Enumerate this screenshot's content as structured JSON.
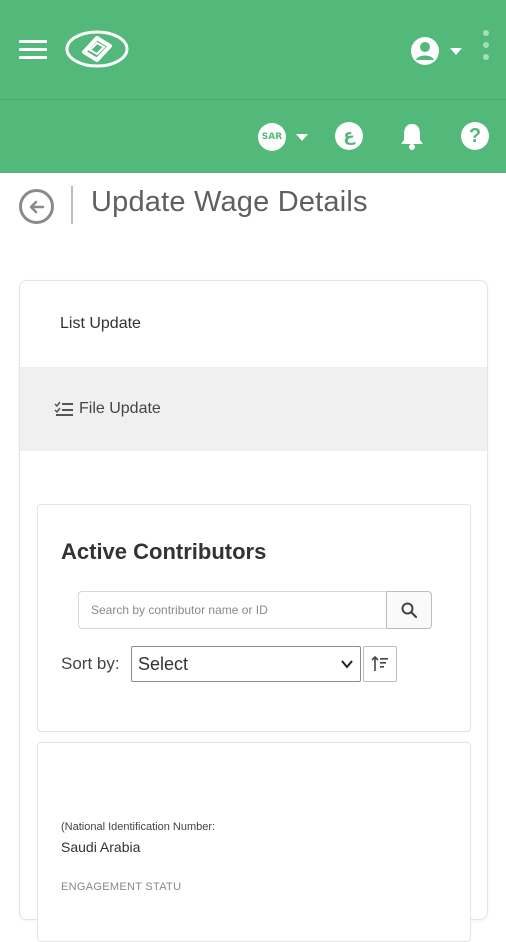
{
  "header": {
    "brand_color": "#53b97a",
    "icons": [
      "hamburger-icon",
      "logo",
      "user-icon",
      "kebab-icon",
      "currency-icon",
      "language-icon",
      "bell-icon",
      "help-icon"
    ],
    "currency_label": "SAR",
    "language_label": "ع",
    "help_label": "?"
  },
  "page": {
    "title": "Update Wage Details"
  },
  "tabs": {
    "list_update": "List Update",
    "file_update": "File Update"
  },
  "contributors": {
    "title": "Active Contributors",
    "search_placeholder": "Search by contributor name or ID",
    "sort_label": "Sort by:",
    "sort_value": "Select"
  },
  "contributor_card": {
    "nin_label": "(National Identification Number:",
    "nationality": "Saudi Arabia",
    "engagement_label": "ENGAGEMENT STATUS"
  }
}
